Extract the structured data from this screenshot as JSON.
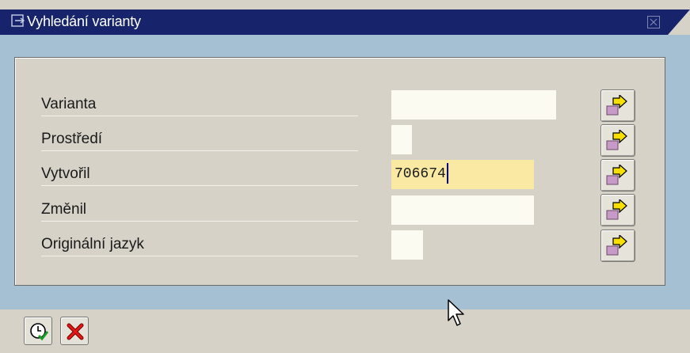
{
  "window": {
    "title": "Vyhledání varianty",
    "icon": "window-menu-icon",
    "close_icon": "close-icon"
  },
  "form": {
    "rows": [
      {
        "label": "Varianta",
        "value": ""
      },
      {
        "label": "Prostředí",
        "value": ""
      },
      {
        "label": "Vytvořil",
        "value": "706674"
      },
      {
        "label": "Změnil",
        "value": ""
      },
      {
        "label": "Originální jazyk",
        "value": ""
      }
    ],
    "multiple_selection_icon": "multiple-selection-arrow-icon"
  },
  "footer": {
    "execute_icon": "execute-clock-check-icon",
    "cancel_icon": "cancel-x-icon"
  },
  "colors": {
    "title_bar": "#17246b",
    "dialog_background": "#a5bfd3",
    "panel": "#d6d2c8",
    "input_active": "#fae9a3",
    "input": "#fcfbf2"
  }
}
